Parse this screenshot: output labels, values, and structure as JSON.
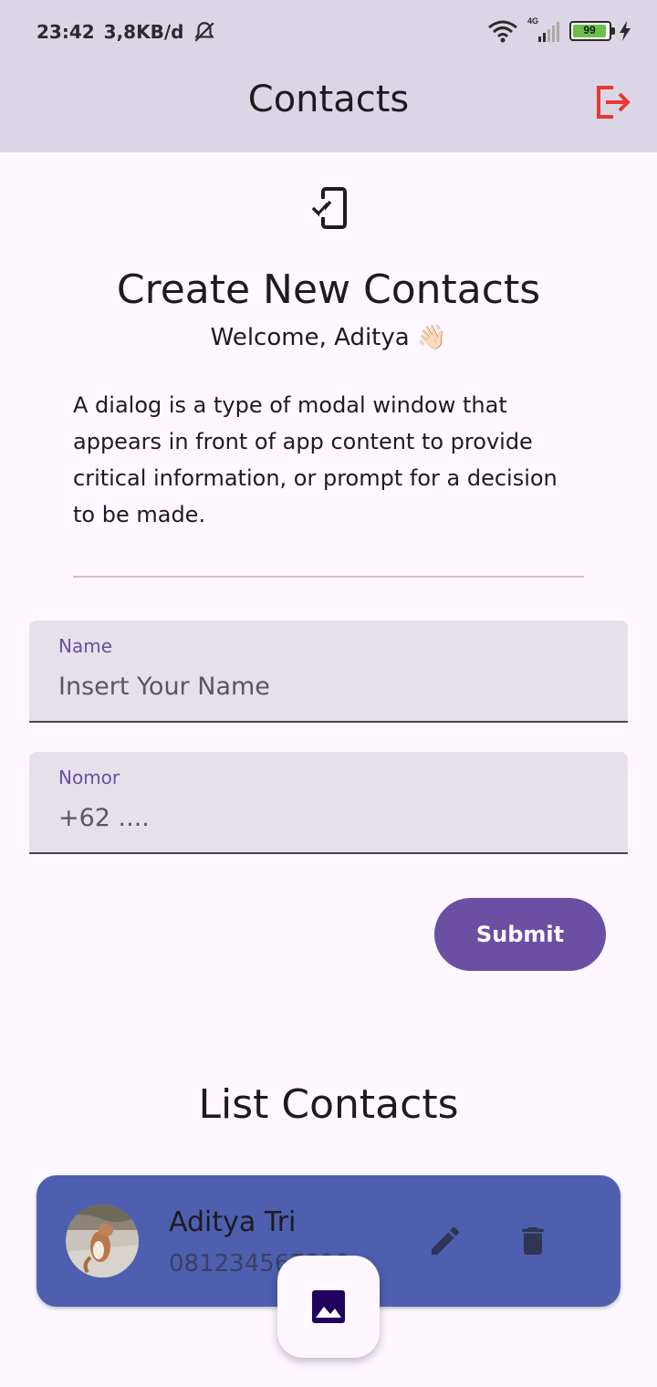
{
  "status_bar": {
    "time": "23:42",
    "speed": "3,8KB/d",
    "network": "4G",
    "battery": "99"
  },
  "app_bar": {
    "title": "Contacts",
    "logout_icon": "logout-icon"
  },
  "header": {
    "icon": "phone-check-icon",
    "title": "Create New Contacts",
    "welcome": "Welcome, Aditya 👋🏻",
    "description": "A dialog is a type of modal window that appears in front of app content to provide critical information, or prompt for a decision to be made."
  },
  "form": {
    "name_label": "Name",
    "name_placeholder": "Insert Your Name",
    "number_label": "Nomor",
    "number_placeholder": "+62 ....",
    "submit_label": "Submit"
  },
  "list": {
    "title": "List Contacts",
    "contacts": [
      {
        "name": "Aditya Tri",
        "phone": "081234567890"
      }
    ]
  },
  "fab": {
    "icon": "image-icon"
  },
  "colors": {
    "app_bar": "#dcd5e6",
    "accent": "#6750a4",
    "logout": "#e53935",
    "card": "#4d5fae",
    "field_bg": "#e6e0e9"
  }
}
